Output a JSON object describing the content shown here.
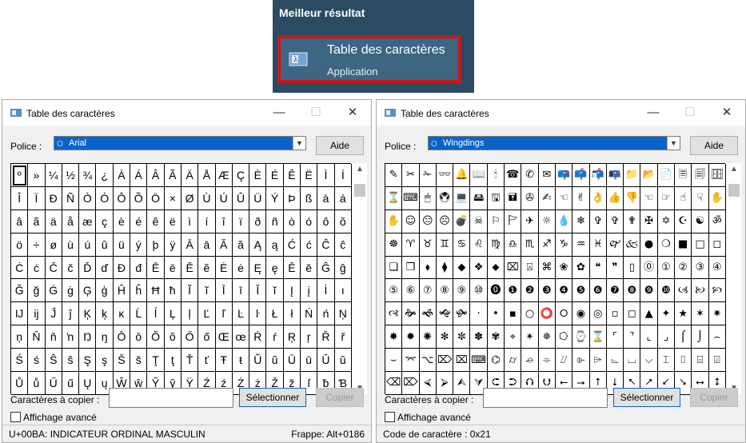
{
  "search": {
    "heading": "Meilleur résultat",
    "result_title": "Table des caractères",
    "result_subtitle": "Application"
  },
  "left_window": {
    "title": "Table des caractères",
    "font_label": "Police :",
    "font_value": "Arial",
    "help_label": "Aide",
    "copy_label": "Caractères à copier :",
    "copy_value": "",
    "select_label": "Sélectionner",
    "copy_button": "Copier",
    "advanced_label": "Affichage avancé",
    "status_left": "U+00BA: INDICATEUR ORDINAL MASCULIN",
    "status_right": "Frappe: Alt+0186",
    "rows": [
      [
        "º",
        "»",
        "¼",
        "½",
        "¾",
        "¿",
        "À",
        "Á",
        "Â",
        "Ã",
        "Ä",
        "Å",
        "Æ",
        "Ç",
        "È",
        "É",
        "Ê",
        "Ë",
        "Ì",
        "Í"
      ],
      [
        "Î",
        "Ï",
        "Ð",
        "Ñ",
        "Ò",
        "Ó",
        "Ô",
        "Õ",
        "Ö",
        "×",
        "Ø",
        "Ù",
        "Ú",
        "Û",
        "Ü",
        "Ý",
        "Þ",
        "ß",
        "à",
        "á"
      ],
      [
        "â",
        "ã",
        "ä",
        "å",
        "æ",
        "ç",
        "è",
        "é",
        "ê",
        "ë",
        "ì",
        "í",
        "î",
        "ï",
        "ð",
        "ñ",
        "ò",
        "ó",
        "ô",
        "õ"
      ],
      [
        "ö",
        "÷",
        "ø",
        "ù",
        "ú",
        "û",
        "ü",
        "ý",
        "þ",
        "ÿ",
        "Ā",
        "ā",
        "Ă",
        "ă",
        "Ą",
        "ą",
        "Ć",
        "ć",
        "Ĉ",
        "ĉ"
      ],
      [
        "Ċ",
        "ċ",
        "Č",
        "č",
        "Ď",
        "ď",
        "Đ",
        "đ",
        "Ē",
        "ē",
        "Ĕ",
        "ĕ",
        "Ė",
        "ė",
        "Ę",
        "ę",
        "Ě",
        "ě",
        "Ĝ",
        "ĝ"
      ],
      [
        "Ğ",
        "ğ",
        "Ġ",
        "ġ",
        "Ģ",
        "ģ",
        "Ĥ",
        "ĥ",
        "Ħ",
        "ħ",
        "Ĩ",
        "ĩ",
        "Ī",
        "ī",
        "Ĭ",
        "ĭ",
        "Į",
        "į",
        "İ",
        "ı"
      ],
      [
        "Ĳ",
        "ĳ",
        "Ĵ",
        "ĵ",
        "Ķ",
        "ķ",
        "ĸ",
        "Ĺ",
        "ĺ",
        "Ļ",
        "ļ",
        "Ľ",
        "ľ",
        "Ŀ",
        "ŀ",
        "Ł",
        "ł",
        "Ń",
        "ń",
        "Ņ"
      ],
      [
        "ņ",
        "Ň",
        "ň",
        "ŉ",
        "Ŋ",
        "ŋ",
        "Ō",
        "ō",
        "Ŏ",
        "ŏ",
        "Ő",
        "ő",
        "Œ",
        "œ",
        "Ŕ",
        "ŕ",
        "Ŗ",
        "ŗ",
        "Ř",
        "ř"
      ],
      [
        "Ś",
        "ś",
        "Ŝ",
        "ŝ",
        "Ş",
        "ş",
        "Š",
        "š",
        "Ţ",
        "ţ",
        "Ť",
        "ť",
        "Ŧ",
        "ŧ",
        "Ũ",
        "ũ",
        "Ū",
        "ū",
        "Ŭ",
        "ŭ"
      ],
      [
        "Ů",
        "ů",
        "Ű",
        "ű",
        "Ų",
        "ų",
        "Ŵ",
        "ŵ",
        "Ŷ",
        "ŷ",
        "Ÿ",
        "Ź",
        "ź",
        "Ż",
        "ż",
        "Ž",
        "ž",
        "ſ",
        "ƀ",
        "Ɓ"
      ]
    ]
  },
  "right_window": {
    "title": "Table des caractères",
    "font_label": "Police :",
    "font_value": "Wingdings",
    "help_label": "Aide",
    "copy_label": "Caractères à copier :",
    "copy_value": "",
    "select_label": "Sélectionner",
    "copy_button": "Copier",
    "advanced_label": "Affichage avancé",
    "status_left": "Code de caractère : 0x21",
    "status_right": "",
    "rows": [
      [
        "✎",
        "✂",
        "✁",
        "👓",
        "🔔",
        "📖",
        "🕯",
        "☎",
        "✆",
        "✉",
        "📪",
        "📫",
        "📬",
        "📭",
        "📁",
        "📂",
        "📄",
        "🗏",
        "🗐",
        "🗄"
      ],
      [
        "⌛",
        "⌨",
        "🖱",
        "🖲",
        "💻",
        "🖴",
        "🖫",
        "🖬",
        "✇",
        "✍",
        "☜",
        "✌",
        "👌",
        "👍",
        "👎",
        "☜",
        "☞",
        "☝",
        "☟",
        "✋"
      ],
      [
        "✋",
        "☺",
        "😐",
        "☹",
        "💣",
        "☠",
        "⚐",
        "🏱",
        "✈",
        "☼",
        "💧",
        "❄",
        "✞",
        "✞",
        "✟",
        "✠",
        "✡",
        "☪",
        "☯",
        "ॐ"
      ],
      [
        "☸",
        "♈",
        "♉",
        "♊",
        "♋",
        "♌",
        "♍",
        "♎",
        "♏",
        "♐",
        "♑",
        "♒",
        "♓",
        "🙰",
        "🙵",
        "●",
        "❍",
        "■",
        "□",
        "◻"
      ],
      [
        "❑",
        "❒",
        "⬧",
        "⧫",
        "◆",
        "❖",
        "⬥",
        "⌧",
        "⍓",
        "⌘",
        "❀",
        "✿",
        "❝",
        "❞",
        "▯",
        "⓪",
        "①",
        "②",
        "③",
        "④"
      ],
      [
        "⑤",
        "⑥",
        "⑦",
        "⑧",
        "⑨",
        "⑩",
        "⓿",
        "❶",
        "❷",
        "❸",
        "❹",
        "❺",
        "❻",
        "❼",
        "❽",
        "❾",
        "❿",
        "🙢",
        "🙠",
        "🙡"
      ],
      [
        "🙣",
        "🙞",
        "🙜",
        "🙝",
        "🙟",
        "·",
        "•",
        "▪",
        "○",
        "⭕",
        "⭘",
        "◉",
        "◎",
        "▫",
        "◻",
        "▲",
        "✦",
        "★",
        "✶",
        "✷"
      ],
      [
        "✸",
        "✹",
        "✺",
        "✻",
        "✼",
        "✽",
        "✾",
        "⌖",
        "✴",
        "✵",
        "⭔",
        "⌚",
        "⌛",
        "⌜",
        "⌝",
        "⌞",
        "⌟",
        "⌠",
        "⌡",
        "⌢"
      ],
      [
        "⌣",
        "⌤",
        "⌥",
        "⌦",
        "⌧",
        "⌨",
        "⌬",
        "⌭",
        "⌮",
        "⌯",
        "⌰",
        "⌱",
        "⌲",
        "⌳",
        "⌴",
        "⌵",
        "⌶",
        "⌷",
        "⌸",
        "⌹"
      ],
      [
        "⌫",
        "⌦",
        "⮘",
        "⮚",
        "⮙",
        "⮛",
        "⮈",
        "⮊",
        "⮉",
        "⮋",
        "⭠",
        "⭢",
        "⭡",
        "⭣",
        "⭦",
        "⭧",
        "⭩",
        "⭨",
        "⭤",
        "⭥"
      ]
    ]
  }
}
